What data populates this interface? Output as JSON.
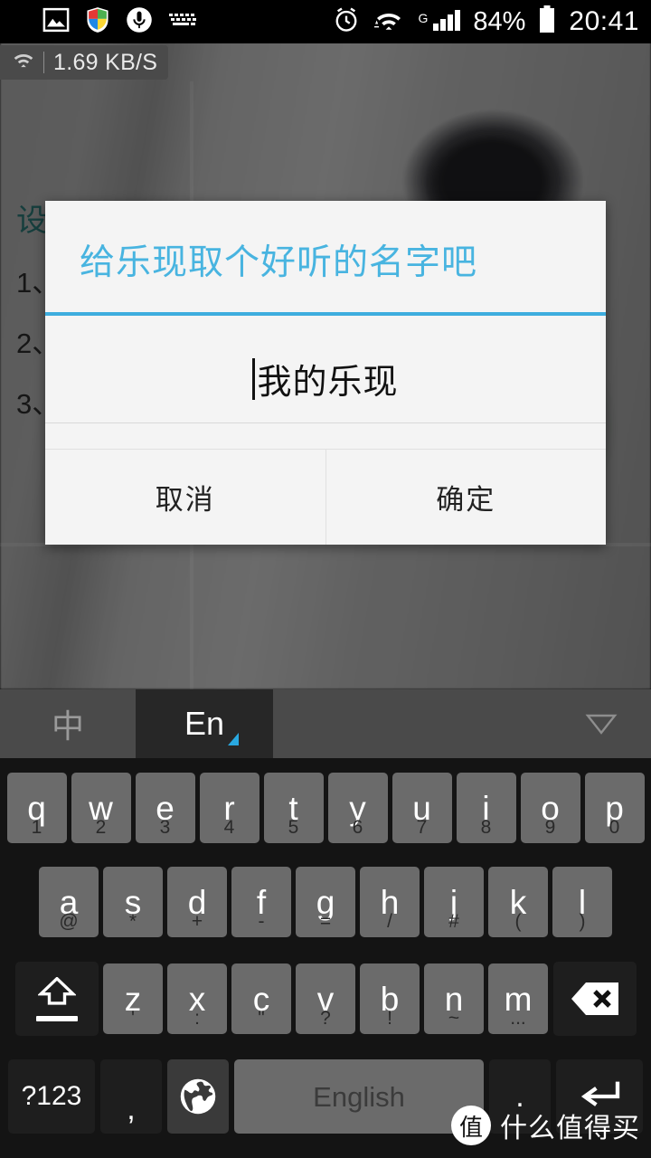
{
  "statusbar": {
    "icons_left": [
      "photo-icon",
      "shield-icon",
      "microphone-icon",
      "keyboard-icon"
    ],
    "icons_right": [
      "alarm-icon",
      "wifi-icon",
      "signal-icon"
    ],
    "network_type": "G",
    "battery_percent": "84%",
    "time": "20:41"
  },
  "speed_badge": {
    "icon": "wifi-icon",
    "value": "1.69 KB/S"
  },
  "background": {
    "title": "设",
    "items": [
      "1、",
      "2、",
      "3、"
    ]
  },
  "dialog": {
    "title": "给乐现取个好听的名字吧",
    "input_value": "我的乐现",
    "input_placeholder": "",
    "cancel_label": "取消",
    "ok_label": "确定",
    "accent_color": "#3eadde",
    "title_color": "#48b4e0"
  },
  "keyboard": {
    "lang_cn": "中",
    "lang_en": "En",
    "collapse_icon": "chevron-down-icon",
    "active_lang": "En",
    "rows": [
      [
        {
          "main": "q",
          "sub": "1"
        },
        {
          "main": "w",
          "sub": "2"
        },
        {
          "main": "e",
          "sub": "3"
        },
        {
          "main": "r",
          "sub": "4"
        },
        {
          "main": "t",
          "sub": "5"
        },
        {
          "main": "y",
          "sub": "6"
        },
        {
          "main": "u",
          "sub": "7"
        },
        {
          "main": "i",
          "sub": "8"
        },
        {
          "main": "o",
          "sub": "9"
        },
        {
          "main": "p",
          "sub": "0"
        }
      ],
      [
        {
          "main": "a",
          "sub": "@"
        },
        {
          "main": "s",
          "sub": "*"
        },
        {
          "main": "d",
          "sub": "+"
        },
        {
          "main": "f",
          "sub": "-"
        },
        {
          "main": "g",
          "sub": "="
        },
        {
          "main": "h",
          "sub": "/"
        },
        {
          "main": "j",
          "sub": "#"
        },
        {
          "main": "k",
          "sub": "("
        },
        {
          "main": "l",
          "sub": ")"
        }
      ],
      [
        {
          "main": "z",
          "sub": "'"
        },
        {
          "main": "x",
          "sub": ":"
        },
        {
          "main": "c",
          "sub": "\""
        },
        {
          "main": "v",
          "sub": "?"
        },
        {
          "main": "b",
          "sub": "!"
        },
        {
          "main": "n",
          "sub": "~"
        },
        {
          "main": "m",
          "sub": "..."
        }
      ]
    ],
    "shift_icon": "shift-icon",
    "backspace_icon": "backspace-icon",
    "symbols_label": "?123",
    "comma_label": ",",
    "globe_icon": "globe-icon",
    "space_label": "English",
    "period_label": ".",
    "enter_icon": "enter-icon"
  },
  "watermark": {
    "badge": "值",
    "text": "什么值得买"
  }
}
